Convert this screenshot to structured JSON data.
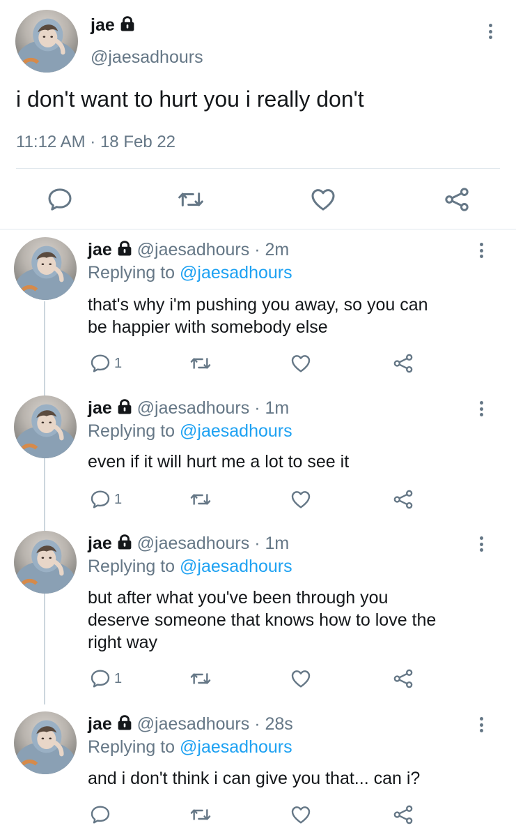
{
  "main_tweet": {
    "name": "jae",
    "handle": "@jaesadhours",
    "text": "i don't want to hurt you i really don't",
    "timestamp": "11:12 AM · 18 Feb 22"
  },
  "replies": [
    {
      "name": "jae",
      "handle": "@jaesadhours",
      "time": "· 2m",
      "replying_prefix": "Replying to",
      "replying_to": "@jaesadhours",
      "text_lines": [
        "that's why i'm pushing you away, so you can",
        "be happier with somebody else"
      ],
      "reply_count": "1"
    },
    {
      "name": "jae",
      "handle": "@jaesadhours",
      "time": "· 1m",
      "replying_prefix": "Replying to",
      "replying_to": "@jaesadhours",
      "text_lines": [
        "even if it will hurt me a lot to see it"
      ],
      "reply_count": "1"
    },
    {
      "name": "jae",
      "handle": "@jaesadhours",
      "time": "· 1m",
      "replying_prefix": "Replying to",
      "replying_to": "@jaesadhours",
      "text_lines": [
        "but after what you've been through you",
        "deserve someone that knows how to love the",
        "right way"
      ],
      "reply_count": "1"
    },
    {
      "name": "jae",
      "handle": "@jaesadhours",
      "time": "· 28s",
      "replying_prefix": "Replying to",
      "replying_to": "@jaesadhours",
      "text_lines": [
        "and i don't think i can give you that... can i?"
      ],
      "reply_count": ""
    }
  ],
  "colors": {
    "link": "#1da1f2",
    "muted": "#657786",
    "divider": "#e1e8ed"
  },
  "icons": [
    "lock-icon",
    "more-icon",
    "reply-icon",
    "retweet-icon",
    "like-icon",
    "share-icon"
  ]
}
